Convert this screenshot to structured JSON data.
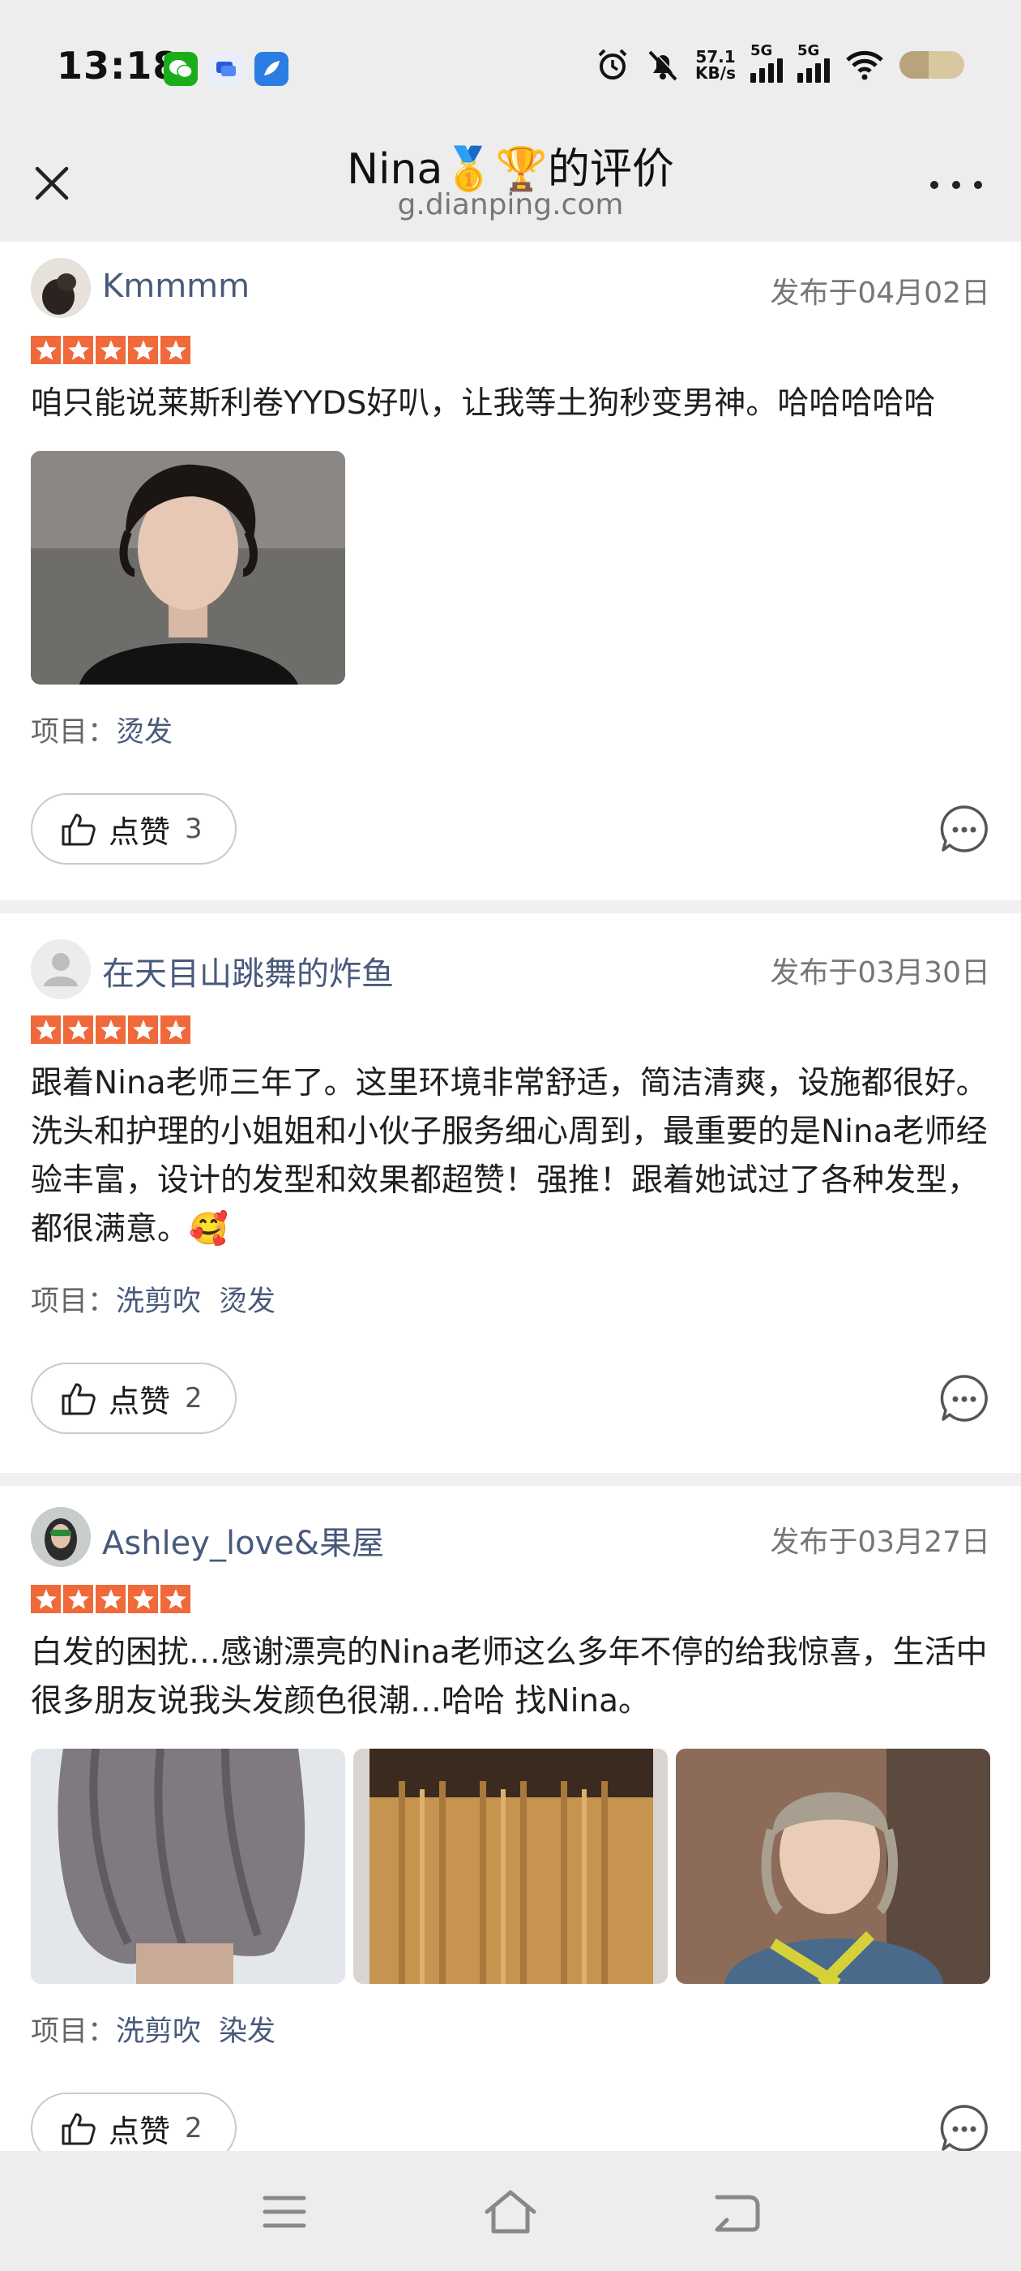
{
  "status_bar": {
    "time": "13:18",
    "net_speed_value": "57.1",
    "net_speed_unit": "KB/s",
    "signal1_label": "5G",
    "signal2_label": "5G",
    "battery_level": 0.45,
    "icons": [
      "wechat-icon",
      "message-icon",
      "feather-app-icon",
      "alarm-icon",
      "mute-bell-icon",
      "wifi-icon",
      "battery-icon"
    ]
  },
  "header": {
    "title": "Nina🥇🏆的评价",
    "subtitle": "g.dianping.com"
  },
  "reviews": [
    {
      "username": "Kmmmm",
      "date": "发布于04月02日",
      "rating": 5,
      "text": "咱只能说莱斯利卷YYDS好叭，让我等土狗秒变男神。哈哈哈哈哈",
      "tags_label": "项目：",
      "tags": [
        "烫发"
      ],
      "like_label": "点赞",
      "like_count": "3"
    },
    {
      "username": "在天目山跳舞的炸鱼",
      "date": "发布于03月30日",
      "rating": 5,
      "text": "跟着Nina老师三年了。这里环境非常舒适，简洁清爽，设施都很好。洗头和护理的小姐姐和小伙子服务细心周到，最重要的是Nina老师经验丰富，设计的发型和效果都超赞！强推！跟着她试过了各种发型，都很满意。🥰",
      "tags_label": "项目：",
      "tags": [
        "洗剪吹",
        "烫发"
      ],
      "like_label": "点赞",
      "like_count": "2"
    },
    {
      "username": "Ashley_love&果屋",
      "date": "发布于03月27日",
      "rating": 5,
      "text": "白发的困扰…感谢漂亮的Nina老师这么多年不停的给我惊喜，生活中很多朋友说我头发颜色很潮…哈哈 找Nina。",
      "tags_label": "项目：",
      "tags": [
        "洗剪吹",
        "染发"
      ],
      "like_label": "点赞",
      "like_count": "2"
    }
  ],
  "colors": {
    "star": "#f0693a",
    "link": "#485a7c",
    "bar_bg": "#ededed"
  }
}
